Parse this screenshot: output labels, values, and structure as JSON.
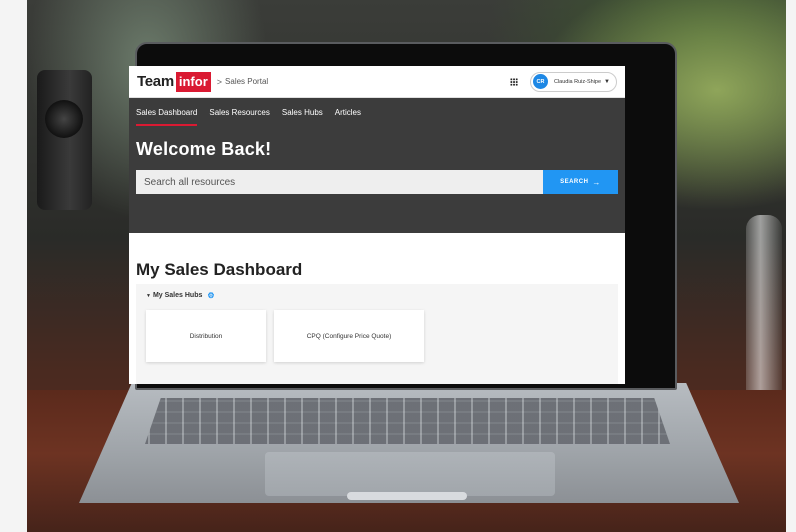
{
  "header": {
    "logo_team": "Team",
    "logo_infor": "infor",
    "breadcrumb": "Sales Portal",
    "apps_icon": "grid-icon",
    "user": {
      "initials": "CR",
      "name": "Claudia Ruiz-Shipe"
    }
  },
  "nav": {
    "items": [
      {
        "label": "Sales Dashboard",
        "active": true
      },
      {
        "label": "Sales Resources"
      },
      {
        "label": "Sales Hubs"
      },
      {
        "label": "Articles"
      }
    ]
  },
  "hero": {
    "welcome": "Welcome Back!",
    "search_placeholder": "Search all resources",
    "search_button": "SEARCH"
  },
  "dashboard": {
    "title": "My Sales Dashboard",
    "hubs_heading": "My Sales Hubs",
    "hubs": [
      {
        "label": "Distribution"
      },
      {
        "label": "CPQ (Configure Price Quote)"
      }
    ]
  },
  "colors": {
    "brand_red": "#da1a32",
    "accent_blue": "#2196f3",
    "hero_bg": "#3c3c3c"
  }
}
